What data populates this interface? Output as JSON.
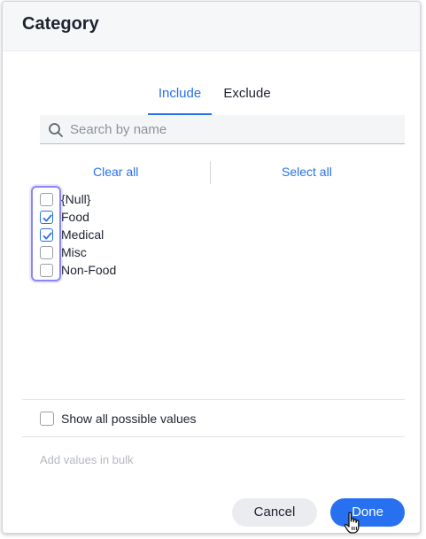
{
  "dialog": {
    "title": "Category"
  },
  "tabs": [
    {
      "label": "Include",
      "active": true
    },
    {
      "label": "Exclude",
      "active": false
    }
  ],
  "search": {
    "placeholder": "Search by name",
    "value": ""
  },
  "actions": {
    "clear_all": "Clear all",
    "select_all": "Select all"
  },
  "values": [
    {
      "label": "{Null}",
      "checked": false
    },
    {
      "label": "Food",
      "checked": true
    },
    {
      "label": "Medical",
      "checked": true
    },
    {
      "label": "Misc",
      "checked": false
    },
    {
      "label": "Non-Food",
      "checked": false
    }
  ],
  "show_all": {
    "label": "Show all possible values",
    "checked": false
  },
  "bulk": {
    "placeholder": "Add values in bulk"
  },
  "footer": {
    "cancel_label": "Cancel",
    "done_label": "Done"
  },
  "colors": {
    "accent": "#2770ef",
    "focus": "#8a85f4",
    "header_bg": "#f6f7f9"
  },
  "icons": {
    "search": "search-icon",
    "check": "checkmark-icon",
    "cursor": "hand-pointer-icon"
  }
}
